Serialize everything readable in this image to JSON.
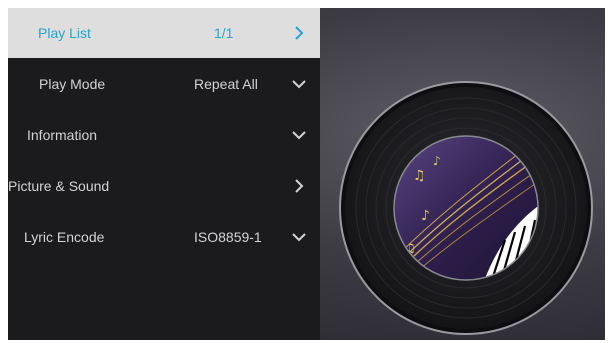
{
  "menu": {
    "items": [
      {
        "label": "Play List",
        "value": "1/1",
        "icon": "chevron-right-icon",
        "active": true
      },
      {
        "label": "Play Mode",
        "value": "Repeat All",
        "icon": "chevron-down-icon"
      },
      {
        "label": "Information",
        "value": "",
        "icon": "chevron-down-icon"
      },
      {
        "label": "Picture & Sound",
        "value": "",
        "icon": "chevron-right-icon"
      },
      {
        "label": "Lyric Encode",
        "value": "ISO8859-1",
        "icon": "chevron-down-icon"
      }
    ]
  },
  "colors": {
    "active_bg": "#dedede",
    "active_text": "#2aa3cc",
    "menu_bg": "#1b1b1e",
    "text": "#d3d3d3"
  },
  "album_art": {
    "icon": "vinyl-record-piano-music-notes"
  }
}
